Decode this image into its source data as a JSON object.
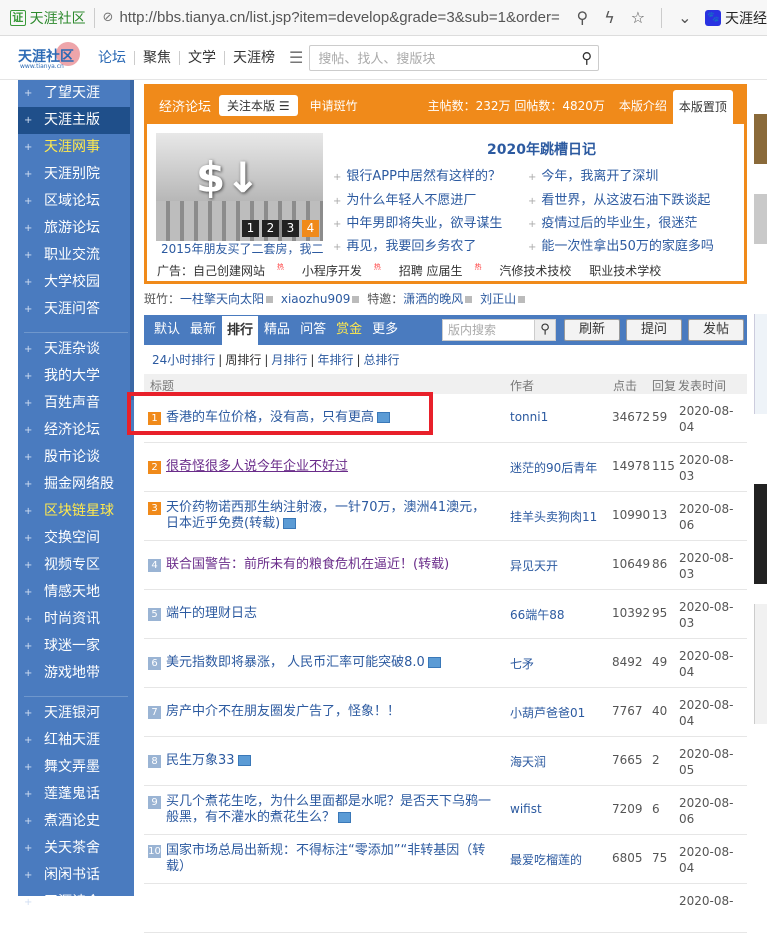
{
  "browser": {
    "tab_title": "天涯社区",
    "url": "http://bbs.tianya.cn/list.jsp?item=develop&grade=3&sub=1&order=",
    "tab2_title": "天涯经"
  },
  "header": {
    "logo_text": "天涯社区",
    "logo_url": "www.tianya.cn",
    "nav": [
      "论坛",
      "聚焦",
      "文学",
      "天涯榜"
    ],
    "search_placeholder": "搜帖、找人、搜版块"
  },
  "sidebar": {
    "groups": [
      [
        {
          "label": "了望天涯",
          "style": "normal"
        },
        {
          "label": "天涯主版",
          "style": "active"
        },
        {
          "label": "天涯网事",
          "style": "yellow"
        },
        {
          "label": "天涯别院",
          "style": "normal"
        },
        {
          "label": "区域论坛",
          "style": "normal"
        },
        {
          "label": "旅游论坛",
          "style": "normal"
        },
        {
          "label": "职业交流",
          "style": "normal"
        },
        {
          "label": "大学校园",
          "style": "normal"
        },
        {
          "label": "天涯问答",
          "style": "normal"
        }
      ],
      [
        {
          "label": "天涯杂谈",
          "style": "normal"
        },
        {
          "label": "我的大学",
          "style": "normal"
        },
        {
          "label": "百姓声音",
          "style": "normal"
        },
        {
          "label": "经济论坛",
          "style": "normal"
        },
        {
          "label": "股市论谈",
          "style": "normal"
        },
        {
          "label": "掘金网络股",
          "style": "normal"
        },
        {
          "label": "区块链星球",
          "style": "yellow"
        },
        {
          "label": "交换空间",
          "style": "normal"
        },
        {
          "label": "视频专区",
          "style": "normal"
        },
        {
          "label": "情感天地",
          "style": "normal"
        },
        {
          "label": "时尚资讯",
          "style": "normal"
        },
        {
          "label": "球迷一家",
          "style": "normal"
        },
        {
          "label": "游戏地带",
          "style": "normal"
        }
      ],
      [
        {
          "label": "天涯银河",
          "style": "normal"
        },
        {
          "label": "红袖天涯",
          "style": "normal"
        },
        {
          "label": "舞文弄墨",
          "style": "normal"
        },
        {
          "label": "莲蓬鬼话",
          "style": "normal"
        },
        {
          "label": "煮酒论史",
          "style": "normal"
        },
        {
          "label": "关天茶舍",
          "style": "normal"
        },
        {
          "label": "闲闲书话",
          "style": "normal"
        },
        {
          "label": "天涯诗会",
          "style": "normal"
        }
      ]
    ]
  },
  "banner": {
    "forum_name": "经济论坛",
    "follow_label": "关注本版",
    "apply_label": "申请斑竹",
    "post_stats": "主帖数：232万 回帖数：4820万",
    "intro_label": "本版介绍",
    "top_label": "本版置顶",
    "diary_title": "2020年跳槽日记",
    "image_caption": "2015年朋友买了二套房，我二",
    "slide_numbers": [
      "1",
      "2",
      "3",
      "4"
    ],
    "links": [
      "银行APP中居然有这样的？",
      "今年，我离开了深圳",
      "为什么年轻人不愿进厂",
      "看世界，从这波石油下跌谈起",
      "中年男即将失业，欲寻谋生",
      "疫情过后的毕业生，很迷茫",
      "再见，我要回乡务农了",
      "能一次性拿出50万的家庭多吗"
    ],
    "ads": [
      "广告：自己创建网站",
      "小程序开发",
      "招聘 应届生",
      "汽修技术技校",
      "职业技术学校"
    ],
    "hot_label": "热"
  },
  "moderators": {
    "label1": "斑竹：",
    "names1": [
      "一柱擎天向太阳",
      "xiaozhu909"
    ],
    "label2": "特邀：",
    "names2": [
      "潇洒的晚风",
      "刘正山"
    ]
  },
  "tabs": {
    "items": [
      "默认",
      "最新",
      "排行",
      "精品",
      "问答",
      "赏金",
      "更多"
    ],
    "active": "排行",
    "search_placeholder": "版内搜索",
    "refresh": "刷新",
    "ask": "提问",
    "post": "发帖"
  },
  "rank_links": [
    "24小时排行",
    "周排行",
    "月排行",
    "年排行",
    "总排行"
  ],
  "table": {
    "headers": [
      "标题",
      "作者",
      "点击",
      "回复",
      "发表时间"
    ],
    "rows": [
      {
        "rank": "1",
        "title": "香港的车位价格，没有高，只有更高",
        "author": "tonni1",
        "clicks": "34672",
        "replies": "59",
        "date": "2020-08-04",
        "pic": true,
        "style": "normal"
      },
      {
        "rank": "2",
        "title": "很奇怪很多人说今年企业不好过",
        "author": "迷茫的90后青年",
        "clicks": "14978",
        "replies": "115",
        "date": "2020-08-03",
        "pic": false,
        "style": "visited"
      },
      {
        "rank": "3",
        "title": "天价药物诺西那生纳注射液，一针70万，澳洲41澳元，日本近乎免费(转载)",
        "author": "挂羊头卖狗肉11",
        "clicks": "10990",
        "replies": "13",
        "date": "2020-08-06",
        "pic": true,
        "style": "normal"
      },
      {
        "rank": "4",
        "title": "联合国警告：前所未有的粮食危机在逼近！(转载)",
        "author": "异见天开",
        "clicks": "10649",
        "replies": "86",
        "date": "2020-08-03",
        "pic": false,
        "style": "visited"
      },
      {
        "rank": "5",
        "title": "端午的理财日志",
        "author": "66端午88",
        "clicks": "10392",
        "replies": "95",
        "date": "2020-08-03",
        "pic": false,
        "style": "normal"
      },
      {
        "rank": "6",
        "title": "美元指数即将暴涨， 人民币汇率可能突破8.0",
        "author": "七矛",
        "clicks": "8492",
        "replies": "49",
        "date": "2020-08-04",
        "pic": true,
        "style": "normal"
      },
      {
        "rank": "7",
        "title": "房产中介不在朋友圈发广告了，怪象！！",
        "author": "小葫芦爸爸01",
        "clicks": "7767",
        "replies": "40",
        "date": "2020-08-04",
        "pic": false,
        "style": "normal"
      },
      {
        "rank": "8",
        "title": "民生万象33",
        "author": "海天润",
        "clicks": "7665",
        "replies": "2",
        "date": "2020-08-05",
        "pic": true,
        "style": "normal"
      },
      {
        "rank": "9",
        "title": "买几个煮花生吃，为什么里面都是水呢？是否天下乌鸦一般黑，有不灌水的煮花生么？",
        "author": "wifist",
        "clicks": "7209",
        "replies": "6",
        "date": "2020-08-06",
        "pic": true,
        "style": "normal"
      },
      {
        "rank": "10",
        "title": "国家市场总局出新规：不得标注“零添加”“非转基因（转载）",
        "author": "最爱吃榴莲的",
        "clicks": "6805",
        "replies": "75",
        "date": "2020-08-04",
        "pic": false,
        "style": "normal"
      },
      {
        "rank": "",
        "title": "",
        "author": "",
        "clicks": "",
        "replies": "",
        "date": "2020-08-",
        "pic": false,
        "style": "normal"
      }
    ]
  },
  "colors": {
    "sidebar_bg": "#4a7bbf",
    "sidebar_active": "#1f4f8a",
    "accent_orange": "#f08a1a",
    "link_blue": "#2c5aa0",
    "highlight_red": "#e8202a"
  }
}
